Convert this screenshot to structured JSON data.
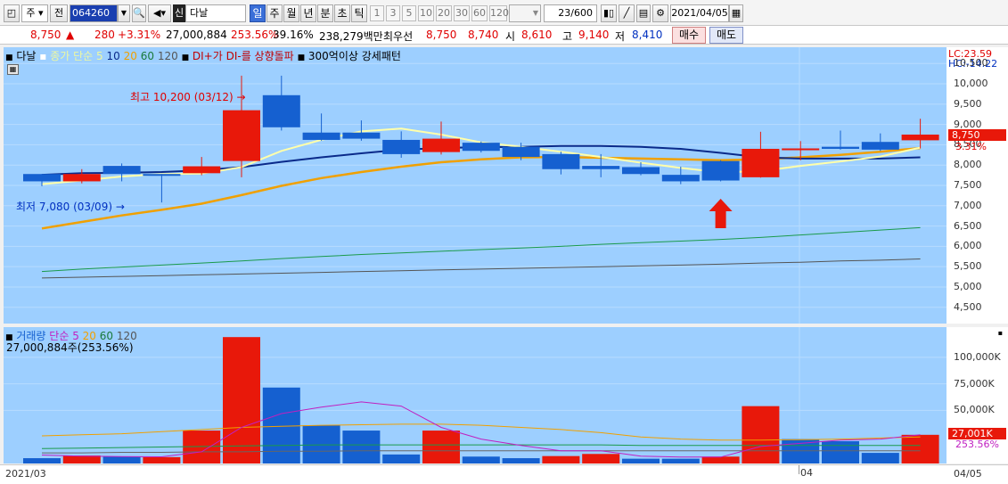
{
  "toolbar": {
    "market_type": "주",
    "prev_label": "전",
    "code": "064260",
    "name": "다날",
    "name_prefix": "신",
    "periods": [
      "일",
      "주",
      "월",
      "년",
      "분",
      "초",
      "틱"
    ],
    "selected_period": "일",
    "intervals": [
      "1",
      "3",
      "5",
      "10",
      "20",
      "30",
      "60",
      "120"
    ],
    "count": "23/600",
    "date": "2021/04/05"
  },
  "quote": {
    "price": "8,750",
    "arrow": "▲",
    "change": "280",
    "change_pct": "+3.31%",
    "volume": "27,000,884",
    "volume_ratio": "253.56%",
    "turnover": "39.16%",
    "amount": "238,279백만",
    "best_label": "최우선",
    "ask": "8,750",
    "bid": "8,740",
    "open_label": "시",
    "open": "8,610",
    "high_label": "고",
    "high": "9,140",
    "low_label": "저",
    "low": "8,410",
    "buy_label": "매수",
    "sell_label": "매도"
  },
  "price_panel": {
    "legend": {
      "name": "다날",
      "ma_label": "종가 단순 5",
      "ma10": "10",
      "ma20": "20",
      "ma60": "60",
      "ma120": "120",
      "signal": "DI+가 DI-를 상향돌파",
      "pattern": "300억이상 강세패턴"
    },
    "lc": "LC:23.59",
    "hc": "HC:-14.22",
    "max_note": "최고 10,200 (03/12)",
    "min_note": "최저 7,080 (03/09)",
    "current_price": "8,750",
    "current_pct": "3.31%",
    "y_ticks": [
      "10,500",
      "10,000",
      "9,500",
      "9,000",
      "8,500",
      "8,000",
      "7,500",
      "7,000",
      "6,500",
      "6,000",
      "5,500",
      "5,000",
      "4,500"
    ]
  },
  "volume_panel": {
    "legend": {
      "name": "거래량",
      "ma_label": "단순 5",
      "ma20": "20",
      "ma60": "60",
      "ma120": "120"
    },
    "summary": "27,000,884주(253.56%)",
    "y_ticks": [
      "100,000K",
      "75,000K",
      "50,000K"
    ],
    "current_volume": "27,001K",
    "current_pct": "253.56%"
  },
  "x_axis": {
    "labels": [
      "2021/03",
      "04",
      "04/05"
    ]
  },
  "colors": {
    "up": "#e8180a",
    "down": "#1560d0",
    "background": "#9dcfff",
    "ma5": "#ffffaa",
    "ma10": "#0a2a8a",
    "ma20": "#f0a000",
    "ma60": "#1a9a4a",
    "ma120": "#555555"
  },
  "chart_data": {
    "type": "candlestick",
    "candles": [
      {
        "o": 7780,
        "h": 7780,
        "l": 7480,
        "c": 7600,
        "dir": "down"
      },
      {
        "o": 7600,
        "h": 7900,
        "l": 7550,
        "c": 7780,
        "dir": "up"
      },
      {
        "o": 7980,
        "h": 8040,
        "l": 7600,
        "c": 7780,
        "dir": "down"
      },
      {
        "o": 7780,
        "h": 7780,
        "l": 7080,
        "c": 7750,
        "dir": "down"
      },
      {
        "o": 7800,
        "h": 8200,
        "l": 7750,
        "c": 7970,
        "dir": "up"
      },
      {
        "o": 8100,
        "h": 10200,
        "l": 7700,
        "c": 9350,
        "dir": "up"
      },
      {
        "o": 9720,
        "h": 10200,
        "l": 8850,
        "c": 8930,
        "dir": "down"
      },
      {
        "o": 8800,
        "h": 9270,
        "l": 8600,
        "c": 8620,
        "dir": "down"
      },
      {
        "o": 8800,
        "h": 9100,
        "l": 8600,
        "c": 8650,
        "dir": "down"
      },
      {
        "o": 8620,
        "h": 8830,
        "l": 8180,
        "c": 8270,
        "dir": "down"
      },
      {
        "o": 8320,
        "h": 9070,
        "l": 8260,
        "c": 8650,
        "dir": "up"
      },
      {
        "o": 8550,
        "h": 8580,
        "l": 8310,
        "c": 8350,
        "dir": "down"
      },
      {
        "o": 8450,
        "h": 8550,
        "l": 8120,
        "c": 8200,
        "dir": "down"
      },
      {
        "o": 8270,
        "h": 8330,
        "l": 7770,
        "c": 7900,
        "dir": "down"
      },
      {
        "o": 7980,
        "h": 8270,
        "l": 7700,
        "c": 7900,
        "dir": "down"
      },
      {
        "o": 7950,
        "h": 8070,
        "l": 7750,
        "c": 7780,
        "dir": "down"
      },
      {
        "o": 7760,
        "h": 7960,
        "l": 7530,
        "c": 7600,
        "dir": "down"
      },
      {
        "o": 8100,
        "h": 8120,
        "l": 7600,
        "c": 7620,
        "dir": "down"
      },
      {
        "o": 7700,
        "h": 8820,
        "l": 7690,
        "c": 8400,
        "dir": "up"
      },
      {
        "o": 8410,
        "h": 8590,
        "l": 8120,
        "c": 8410,
        "dir": "up"
      },
      {
        "o": 8450,
        "h": 8850,
        "l": 8380,
        "c": 8400,
        "dir": "down"
      },
      {
        "o": 8570,
        "h": 8780,
        "l": 8350,
        "c": 8380,
        "dir": "down"
      },
      {
        "o": 8610,
        "h": 9140,
        "l": 8410,
        "c": 8750,
        "dir": "up"
      }
    ],
    "ma5": [
      7530,
      7620,
      7720,
      7780,
      7790,
      7950,
      8350,
      8620,
      8830,
      8900,
      8750,
      8560,
      8450,
      8330,
      8200,
      8060,
      7930,
      7820,
      7850,
      7980,
      8090,
      8210,
      8430
    ],
    "ma10": [
      7760,
      7800,
      7810,
      7830,
      7870,
      7950,
      8080,
      8190,
      8290,
      8380,
      8420,
      8440,
      8450,
      8470,
      8470,
      8450,
      8400,
      8300,
      8190,
      8160,
      8160,
      8160,
      8190
    ],
    "ma20": [
      6440,
      6600,
      6760,
      6900,
      7050,
      7260,
      7490,
      7680,
      7830,
      7960,
      8070,
      8140,
      8190,
      8200,
      8180,
      8160,
      8140,
      8120,
      8140,
      8190,
      8250,
      8330,
      8420
    ],
    "ma60": [
      5380,
      5440,
      5490,
      5540,
      5590,
      5640,
      5700,
      5750,
      5800,
      5840,
      5880,
      5920,
      5960,
      6000,
      6050,
      6090,
      6130,
      6170,
      6220,
      6280,
      6340,
      6400,
      6460
    ],
    "ma120": [
      5220,
      5240,
      5260,
      5280,
      5300,
      5320,
      5340,
      5360,
      5380,
      5400,
      5420,
      5440,
      5460,
      5480,
      5500,
      5520,
      5540,
      5560,
      5590,
      5610,
      5640,
      5660,
      5690
    ],
    "volume": [
      5000,
      7500,
      6500,
      6000,
      31000,
      119000,
      71500,
      36000,
      31000,
      8500,
      31000,
      6500,
      5000,
      7000,
      9000,
      4500,
      4500,
      6500,
      54000,
      23000,
      21000,
      10000,
      27001
    ],
    "volume_dir": [
      "down",
      "up",
      "down",
      "up",
      "up",
      "up",
      "down",
      "down",
      "down",
      "down",
      "up",
      "down",
      "down",
      "up",
      "up",
      "down",
      "down",
      "up",
      "up",
      "down",
      "down",
      "down",
      "up"
    ],
    "vol_ma5": [
      8000,
      7000,
      6500,
      6300,
      11000,
      34000,
      47000,
      53000,
      58000,
      54000,
      34000,
      23000,
      17000,
      12000,
      12000,
      7000,
      6000,
      6000,
      16000,
      19000,
      22000,
      23000,
      27000
    ],
    "vol_ma20": [
      26000,
      27000,
      28000,
      30000,
      32000,
      34000,
      35000,
      36000,
      36500,
      37000,
      37000,
      36000,
      34000,
      32000,
      29000,
      25000,
      23000,
      22000,
      22000,
      22500,
      23000,
      24000,
      25000
    ],
    "vol_ma60": [
      14000,
      14500,
      15000,
      15500,
      16000,
      16500,
      17000,
      17500,
      17500,
      17500,
      17500,
      17500,
      17500,
      17500,
      17500,
      17000,
      17000,
      17000,
      17000,
      17000,
      17000,
      17000,
      17000
    ],
    "vol_ma120": [
      10000,
      10000,
      10500,
      10500,
      11000,
      11000,
      11500,
      11500,
      12000,
      12000,
      12000,
      12000,
      12000,
      12000,
      12000,
      12000,
      12000,
      12000,
      12000,
      12000,
      12000,
      12000,
      12000
    ],
    "price_ylim": [
      4100,
      10900
    ],
    "vol_ylim": [
      0,
      120000
    ]
  }
}
